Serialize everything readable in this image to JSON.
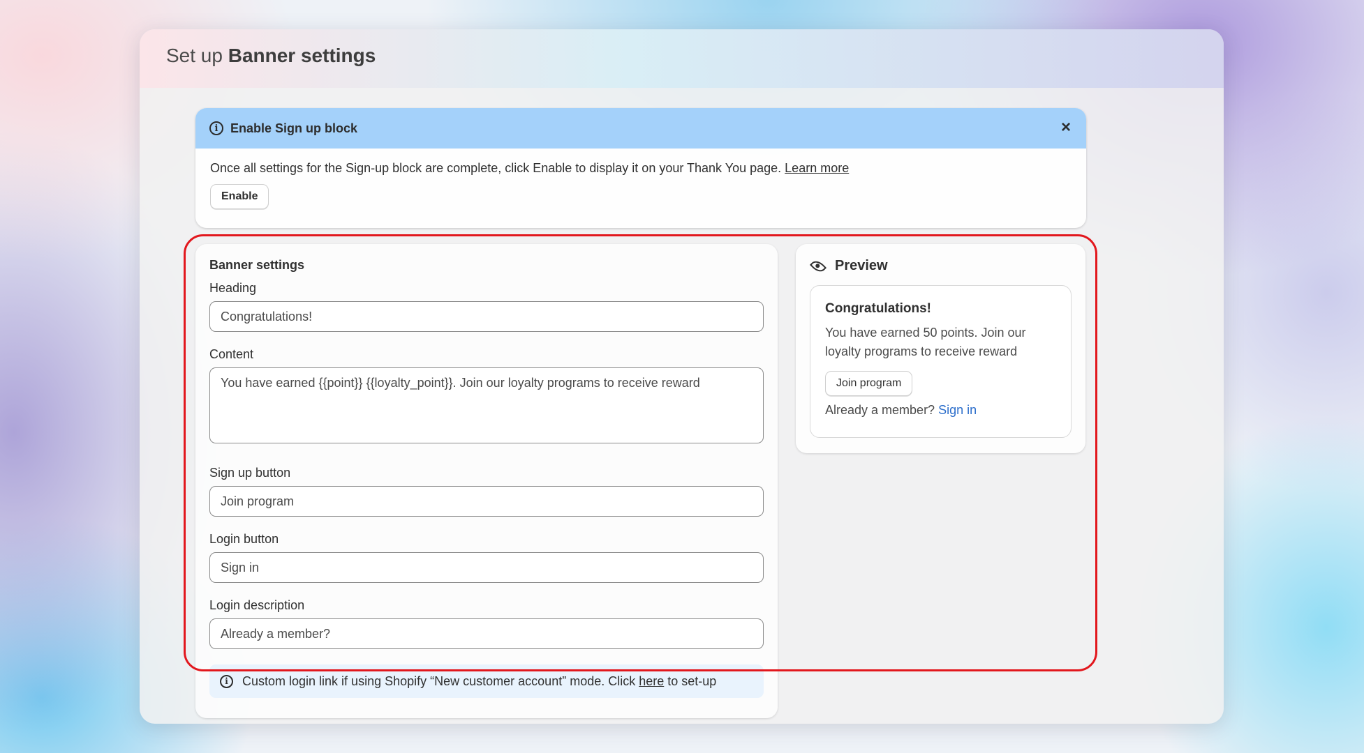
{
  "page": {
    "title_prefix": "Set up",
    "title_bold": "Banner settings"
  },
  "notice": {
    "title": "Enable Sign up block",
    "message": "Once all settings for the Sign-up block are complete, click Enable to display it on your Thank You page.",
    "learn_more": "Learn more",
    "enable_button": "Enable",
    "info_icon": "info-icon",
    "close_icon": "close-icon"
  },
  "settings": {
    "title": "Banner settings",
    "heading_label": "Heading",
    "heading_value": "Congratulations!",
    "content_label": "Content",
    "content_value": "You have earned {{point}} {{loyalty_point}}. Join our loyalty programs to receive reward",
    "signup_label": "Sign up button",
    "signup_value": "Join program",
    "login_label": "Login button",
    "login_value": "Sign in",
    "login_desc_label": "Login description",
    "login_desc_value": "Already a member?",
    "hint_text_before": "Custom login link if using Shopify “New customer account” mode. Click",
    "hint_link": "here",
    "hint_text_after": "to set-up"
  },
  "preview": {
    "title": "Preview",
    "icon": "eye-icon",
    "banner_heading": "Congratulations!",
    "banner_content": "You have earned 50 points. Join our loyalty programs to receive reward",
    "join_button": "Join program",
    "member_text": "Already a member?",
    "sign_in_link": "Sign in"
  },
  "colors": {
    "notice_header": "#a4d1fa",
    "highlight_border": "#e2171d",
    "link_blue": "#2c6ecb",
    "hint_background": "#e9f3fd"
  }
}
